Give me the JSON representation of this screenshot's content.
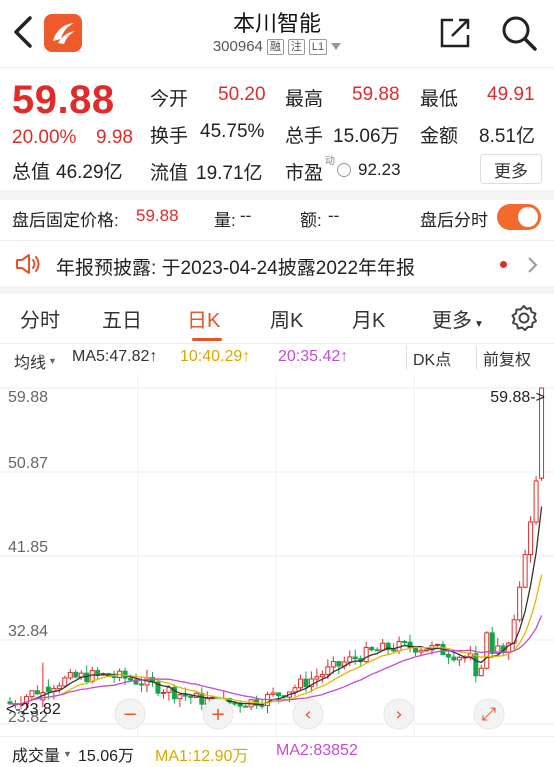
{
  "header": {
    "title": "本川智能",
    "code": "300964",
    "tags": [
      "融",
      "注",
      "L1"
    ]
  },
  "quote": {
    "price": "59.88",
    "change_pct": "20.00%",
    "change_val": "9.98",
    "total_mv_label": "总值",
    "total_mv": "46.29亿",
    "open_label": "今开",
    "open": "50.20",
    "high_label": "最高",
    "high": "59.88",
    "low_label": "最低",
    "low": "49.91",
    "turnover_label": "换手",
    "turnover": "45.75%",
    "volume_label": "总手",
    "volume": "15.06万",
    "amount_label": "金额",
    "amount": "8.51亿",
    "float_mv_label": "流值",
    "float_mv": "19.71亿",
    "pe_label": "市盈",
    "pe_sup": "动",
    "pe": "92.23",
    "more_label": "更多"
  },
  "after_hours": {
    "price_label": "盘后固定价格:",
    "price": "59.88",
    "qty_label": "量:",
    "qty": "--",
    "amt_label": "额:",
    "amt": "--",
    "timeshare_label": "盘后分时",
    "toggle_on": true
  },
  "notice": {
    "text": "年报预披露:  于2023-04-24披露2022年年报"
  },
  "tabs": [
    "分时",
    "五日",
    "日K",
    "周K",
    "月K",
    "更多"
  ],
  "active_tab": "日K",
  "indicator": {
    "type_label": "均线",
    "ma5": "MA5:47.82↑",
    "ma10": "10:40.29↑",
    "ma20": "20:35.42↑",
    "dk_label": "DK点",
    "adjust_label": "前复权",
    "colors": {
      "ma5": "#333333",
      "ma10": "#e6b800",
      "ma20": "#c44bd1",
      "up": "#e02b2b",
      "down": "#17a34a"
    }
  },
  "chart_data": {
    "type": "candlestick",
    "y_ticks": [
      "59.88",
      "50.87",
      "41.85",
      "32.84",
      "23.82"
    ],
    "ylim": [
      23.82,
      59.88
    ],
    "max_marker": "59.88->",
    "min_marker": "<-23.82",
    "controls": [
      "−",
      "+",
      "‹",
      "›",
      "⤢"
    ]
  },
  "volume_bar": {
    "label": "成交量",
    "total": "15.06万",
    "ma1": "MA1:12.90万",
    "ma2": "MA2:83852"
  }
}
